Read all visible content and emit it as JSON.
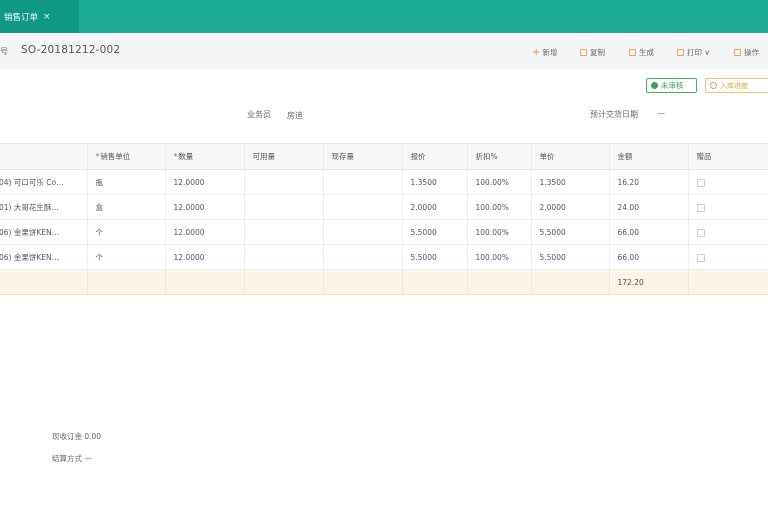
{
  "tab": {
    "title": "销售订单",
    "close": "×"
  },
  "header": {
    "doc_label": "号",
    "doc_no": "SO-20181212-002",
    "buttons": [
      {
        "label": "新增",
        "icon": "plus-icon"
      },
      {
        "label": "复制",
        "icon": "copy-icon"
      },
      {
        "label": "生成",
        "icon": "generate-icon"
      },
      {
        "label": "打印 ∨",
        "icon": "print-icon"
      },
      {
        "label": "操作",
        "icon": "operation-icon"
      }
    ]
  },
  "status": {
    "primary": "未审核",
    "secondary": "入库进度"
  },
  "fields": {
    "salesman_label": "业务员",
    "salesman_value": "房迪",
    "delivery_label": "预计交货日期",
    "delivery_value": "—"
  },
  "table": {
    "columns": [
      {
        "label": "",
        "required": false
      },
      {
        "label": "销售单位",
        "required": true
      },
      {
        "label": "数量",
        "required": true
      },
      {
        "label": "可用量",
        "required": false
      },
      {
        "label": "现存量",
        "required": false
      },
      {
        "label": "报价",
        "required": false
      },
      {
        "label": "折扣%",
        "required": false
      },
      {
        "label": "单价",
        "required": false
      },
      {
        "label": "金额",
        "required": false
      },
      {
        "label": "赠品",
        "required": false
      }
    ],
    "rows": [
      [
        "04) 可口可乐 Co…",
        "瓶",
        "12.0000",
        "",
        "",
        "1.3500",
        "100.00%",
        "1.3500",
        "16.20"
      ],
      [
        "01) 大哥花生酥…",
        "盒",
        "12.0000",
        "",
        "",
        "2.0000",
        "100.00%",
        "2.0000",
        "24.00"
      ],
      [
        "06) 金果饼KEN…",
        "个",
        "12.0000",
        "",
        "",
        "5.5000",
        "100.00%",
        "5.5000",
        "66.00"
      ],
      [
        "06) 金果饼KEN…",
        "个",
        "12.0000",
        "",
        "",
        "5.5000",
        "100.00%",
        "5.5000",
        "66.00"
      ]
    ],
    "total_amount": "172.20"
  },
  "footer": {
    "received_label": "现收订金 0.00",
    "settle_label": "结算方式 —"
  }
}
